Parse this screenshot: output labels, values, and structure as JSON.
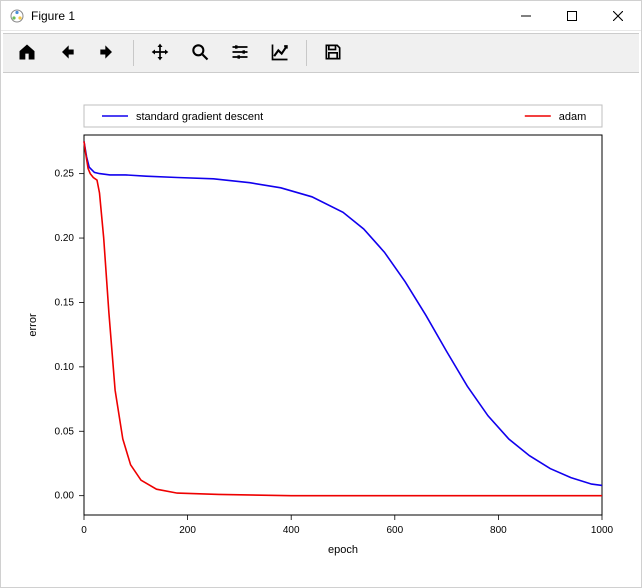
{
  "window": {
    "title": "Figure 1"
  },
  "toolbar": {
    "home": "Home",
    "back": "Back",
    "forward": "Forward",
    "pan": "Pan",
    "zoom": "Zoom",
    "subplots": "Configure subplots",
    "edit": "Edit parameters",
    "save": "Save"
  },
  "chart_data": {
    "type": "line",
    "title": "",
    "xlabel": "epoch",
    "ylabel": "error",
    "xlim": [
      0,
      1000
    ],
    "ylim": [
      -0.015,
      0.28
    ],
    "xticks": [
      0,
      200,
      400,
      600,
      800,
      1000
    ],
    "yticks": [
      0.0,
      0.05,
      0.1,
      0.15,
      0.2,
      0.25
    ],
    "legend_position": "top",
    "series": [
      {
        "name": "standard gradient descent",
        "color": "#1100ee",
        "x": [
          0,
          5,
          10,
          20,
          30,
          50,
          80,
          120,
          180,
          250,
          320,
          380,
          440,
          500,
          540,
          580,
          620,
          660,
          700,
          740,
          780,
          820,
          860,
          900,
          940,
          980,
          1000
        ],
        "y": [
          0.275,
          0.263,
          0.255,
          0.251,
          0.25,
          0.249,
          0.249,
          0.248,
          0.247,
          0.246,
          0.243,
          0.239,
          0.232,
          0.22,
          0.207,
          0.189,
          0.166,
          0.14,
          0.112,
          0.085,
          0.062,
          0.044,
          0.031,
          0.021,
          0.014,
          0.009,
          0.008
        ]
      },
      {
        "name": "adam",
        "color": "#ee0000",
        "x": [
          0,
          3,
          8,
          12,
          18,
          25,
          30,
          38,
          48,
          60,
          75,
          90,
          110,
          140,
          180,
          260,
          400,
          600,
          800,
          1000
        ],
        "y": [
          0.275,
          0.266,
          0.254,
          0.25,
          0.247,
          0.245,
          0.235,
          0.2,
          0.142,
          0.082,
          0.044,
          0.024,
          0.012,
          0.005,
          0.002,
          0.001,
          0.0,
          0.0,
          0.0,
          0.0
        ]
      }
    ]
  }
}
